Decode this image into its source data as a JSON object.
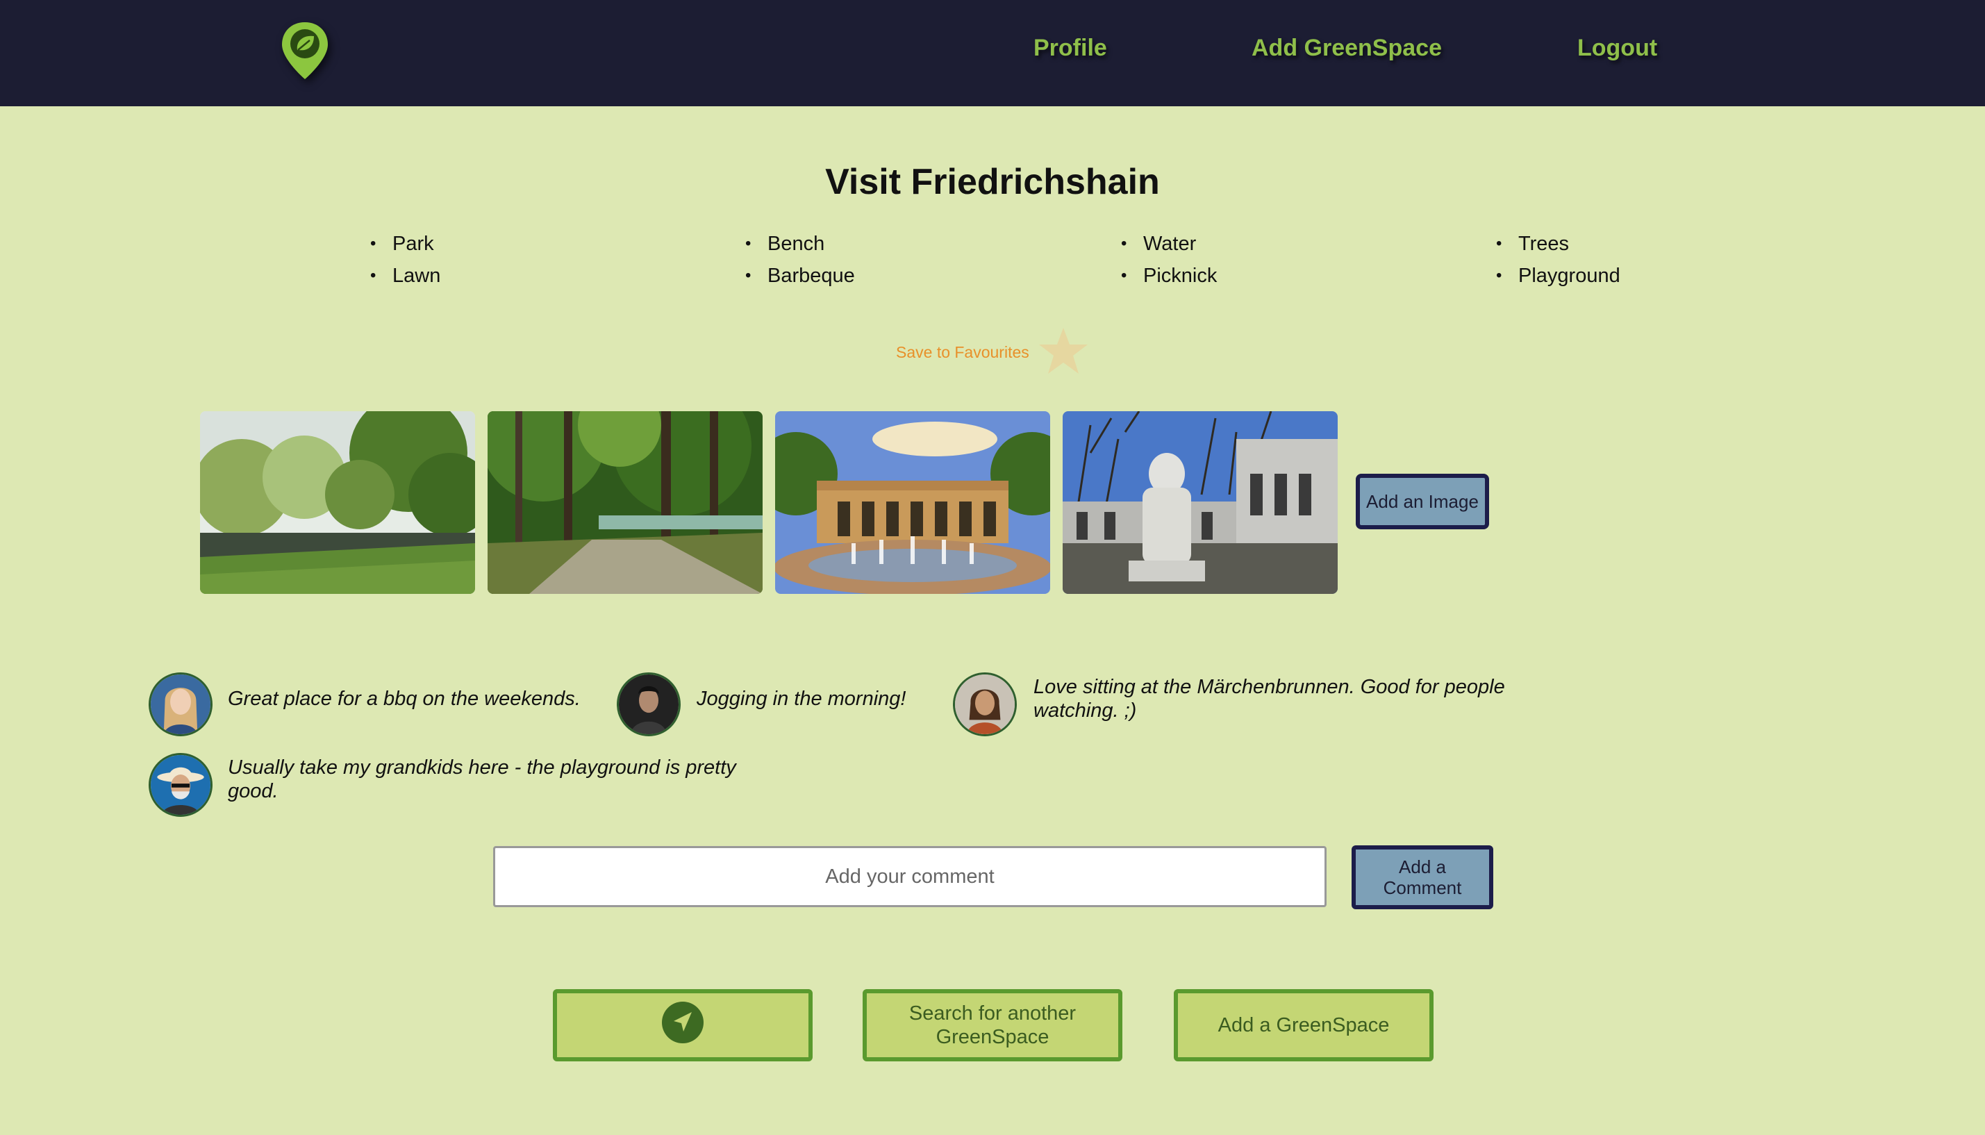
{
  "header": {
    "logo_icon": "map-pin-leaf-icon",
    "nav": [
      {
        "label": "Profile"
      },
      {
        "label": "Add GreenSpace"
      },
      {
        "label": "Logout"
      }
    ]
  },
  "page": {
    "title": "Visit Friedrichshain",
    "features": [
      [
        "Park",
        "Lawn"
      ],
      [
        "Bench",
        "Barbeque"
      ],
      [
        "Water",
        "Picknick"
      ],
      [
        "Trees",
        "Playground"
      ]
    ]
  },
  "favourites": {
    "label": "Save to Favourites",
    "icon": "star-icon"
  },
  "gallery": {
    "add_image_label": "Add an Image"
  },
  "comments": [
    {
      "text": "Great place for a bbq on the weekends."
    },
    {
      "text": "Jogging in the morning!"
    },
    {
      "text": "Love sitting at the Märchenbrunnen. Good for people watching. ;)"
    },
    {
      "text": "Usually take my grandkids here - the playground is pretty good."
    }
  ],
  "comment_form": {
    "placeholder": "Add your comment",
    "value": "",
    "submit_label": "Add a Comment"
  },
  "actions": {
    "locate_icon": "navigation-arrow-icon",
    "search_label": "Search for another GreenSpace",
    "add_label": "Add a GreenSpace"
  },
  "colors": {
    "header_bg": "#1c1d33",
    "page_bg": "#dde8b3",
    "nav_text": "#8fbf4a",
    "fav_text": "#e8902a",
    "blue_button": "#7da0b7",
    "green_button": "#c4d674",
    "green_border": "#5a9a2e"
  }
}
